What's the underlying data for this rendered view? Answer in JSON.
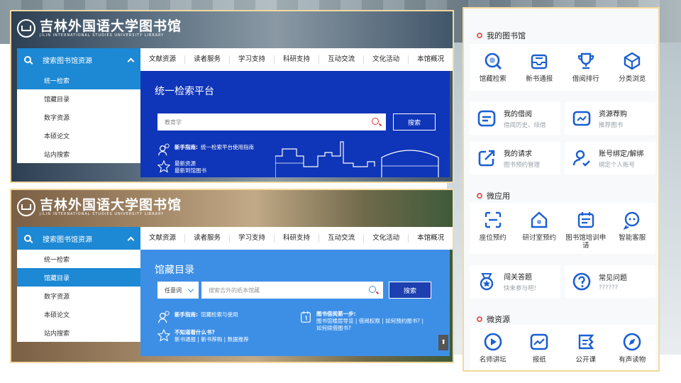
{
  "library_name": "吉林外国语大学图书馆",
  "library_name_en": "JILIN INTERNATIONAL STUDIES UNIVERSITY LIBRARY",
  "sidebar": {
    "header_label": "搜索图书馆资源",
    "items": [
      "统一检索",
      "馆藏目录",
      "数字资源",
      "本硕论文",
      "站内搜索"
    ]
  },
  "topnav": [
    "文献资源",
    "读者服务",
    "学习支持",
    "科研支持",
    "互动交流",
    "文化活动",
    "本馆概况"
  ],
  "screen1": {
    "panel_title": "统一检索平台",
    "search_value": "教育学",
    "search_button": "搜索",
    "tip1_bold": "新手指南:",
    "tip1_text": "统一检索平台使用指南",
    "tip2_line1": "最新资源",
    "tip2_line2": "最新到馆图书"
  },
  "screen2": {
    "panel_title": "馆藏目录",
    "select_value": "任意词",
    "search_placeholder": "搜索吉外的纸本馆藏",
    "search_button": "搜索",
    "tip1_bold": "新手指南:",
    "tip1_text": "馆藏检索与使用",
    "tip2_bold": "不知道看什么书?",
    "tip2_links": "新书通报 | 新书荐购 | 数据推荐",
    "tip3_bold": "图书借阅第一步:",
    "tip3_line1": "图书馆楼层导览 | 借阅权限 | 如何预约图书? |",
    "tip3_line2": "如何续借图书?",
    "scroll_label": "⬆"
  },
  "right": {
    "section1": "我的图书馆",
    "grid1": [
      "馆藏检索",
      "新书通报",
      "借阅排行",
      "分类浏览"
    ],
    "cards1": [
      {
        "title": "我的借阅",
        "sub": "借阅历史、续借"
      },
      {
        "title": "资源荐购",
        "sub": "推荐图书"
      },
      {
        "title": "我的请求",
        "sub": "图书预约管理"
      },
      {
        "title": "账号绑定/解绑",
        "sub": "绑定个人账号"
      }
    ],
    "section2": "微应用",
    "grid2": [
      "座位预约",
      "研讨室预约",
      "图书馆培训申请",
      "智能客服"
    ],
    "cards2": [
      {
        "title": "闯关答题",
        "sub": "快来参与吧!"
      },
      {
        "title": "常见问题",
        "sub": "??????"
      }
    ],
    "section3": "微资源",
    "grid3": [
      "名师讲坛",
      "报纸",
      "公开课",
      "有声读物"
    ],
    "accent_color": "#1a5fd1",
    "bullet_color": "#e45b5b"
  }
}
